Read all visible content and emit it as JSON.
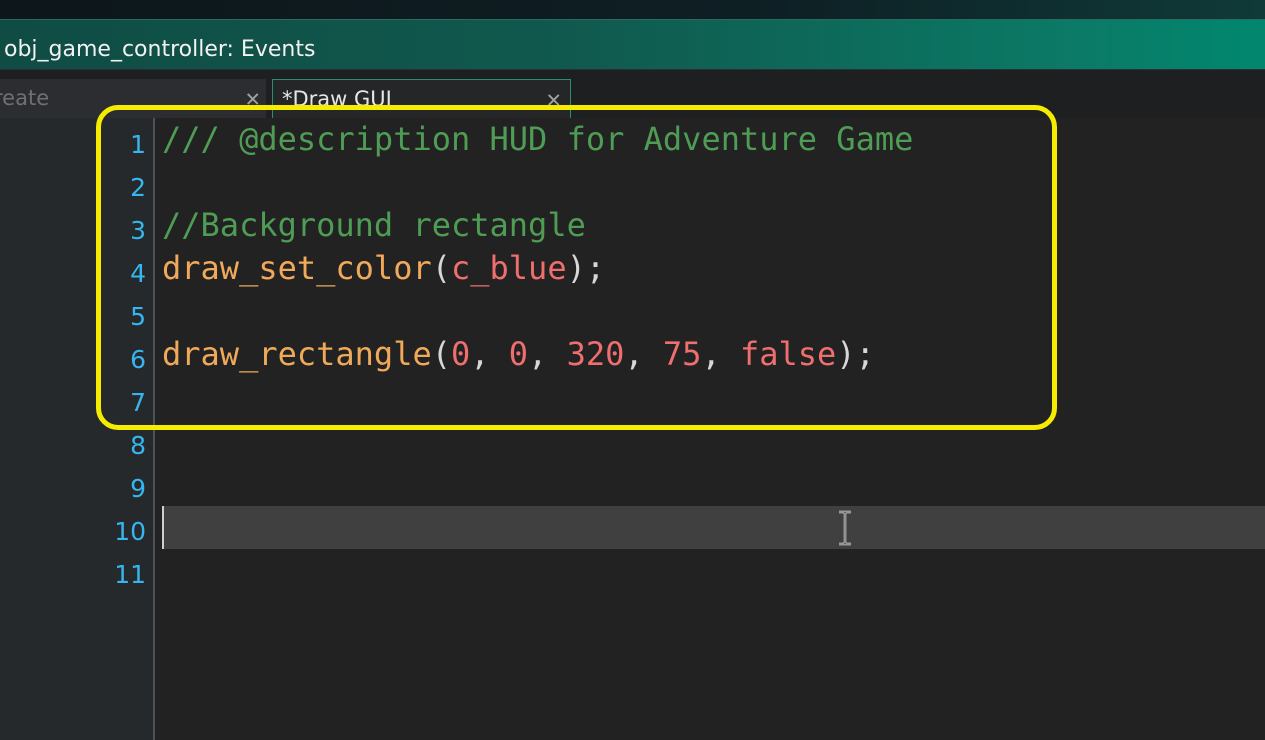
{
  "window": {
    "title": "obj_game_controller: Events"
  },
  "tabs": [
    {
      "label": "reate",
      "close_icon": "close-x",
      "active": false
    },
    {
      "label": "*Draw GUI",
      "close_icon": "close-x",
      "active": true
    }
  ],
  "editor": {
    "line_numbers": [
      "1",
      "2",
      "3",
      "4",
      "5",
      "6",
      "7",
      "8",
      "9",
      "10",
      "11"
    ],
    "current_line": "10",
    "lines": [
      {
        "tokens": [
          {
            "t": "/// @description HUD for Adventure Game",
            "k": "comment"
          }
        ]
      },
      {
        "tokens": []
      },
      {
        "tokens": [
          {
            "t": "//Background rectangle",
            "k": "comment"
          }
        ]
      },
      {
        "tokens": [
          {
            "t": "draw_set_color",
            "k": "func"
          },
          {
            "t": "(",
            "k": "punc"
          },
          {
            "t": "c_blue",
            "k": "const"
          },
          {
            "t": ");",
            "k": "punc"
          }
        ]
      },
      {
        "tokens": []
      },
      {
        "tokens": [
          {
            "t": "draw_rectangle",
            "k": "func"
          },
          {
            "t": "(",
            "k": "punc"
          },
          {
            "t": "0",
            "k": "const"
          },
          {
            "t": ", ",
            "k": "punc"
          },
          {
            "t": "0",
            "k": "const"
          },
          {
            "t": ", ",
            "k": "punc"
          },
          {
            "t": "320",
            "k": "const"
          },
          {
            "t": ", ",
            "k": "punc"
          },
          {
            "t": "75",
            "k": "const"
          },
          {
            "t": ", ",
            "k": "punc"
          },
          {
            "t": "false",
            "k": "const"
          },
          {
            "t": ");",
            "k": "punc"
          }
        ]
      },
      {
        "tokens": []
      },
      {
        "tokens": []
      },
      {
        "tokens": []
      },
      {
        "tokens": []
      },
      {
        "tokens": []
      }
    ]
  },
  "colors": {
    "comment": "#4f9c55",
    "function": "#f0a95a",
    "constant": "#ef6e6e",
    "line_number": "#35b6ef",
    "annotation_box": "#f5ec00",
    "titlebar_accent": "#01876e"
  },
  "cursor": {
    "icon": "text-ibeam-cursor"
  }
}
